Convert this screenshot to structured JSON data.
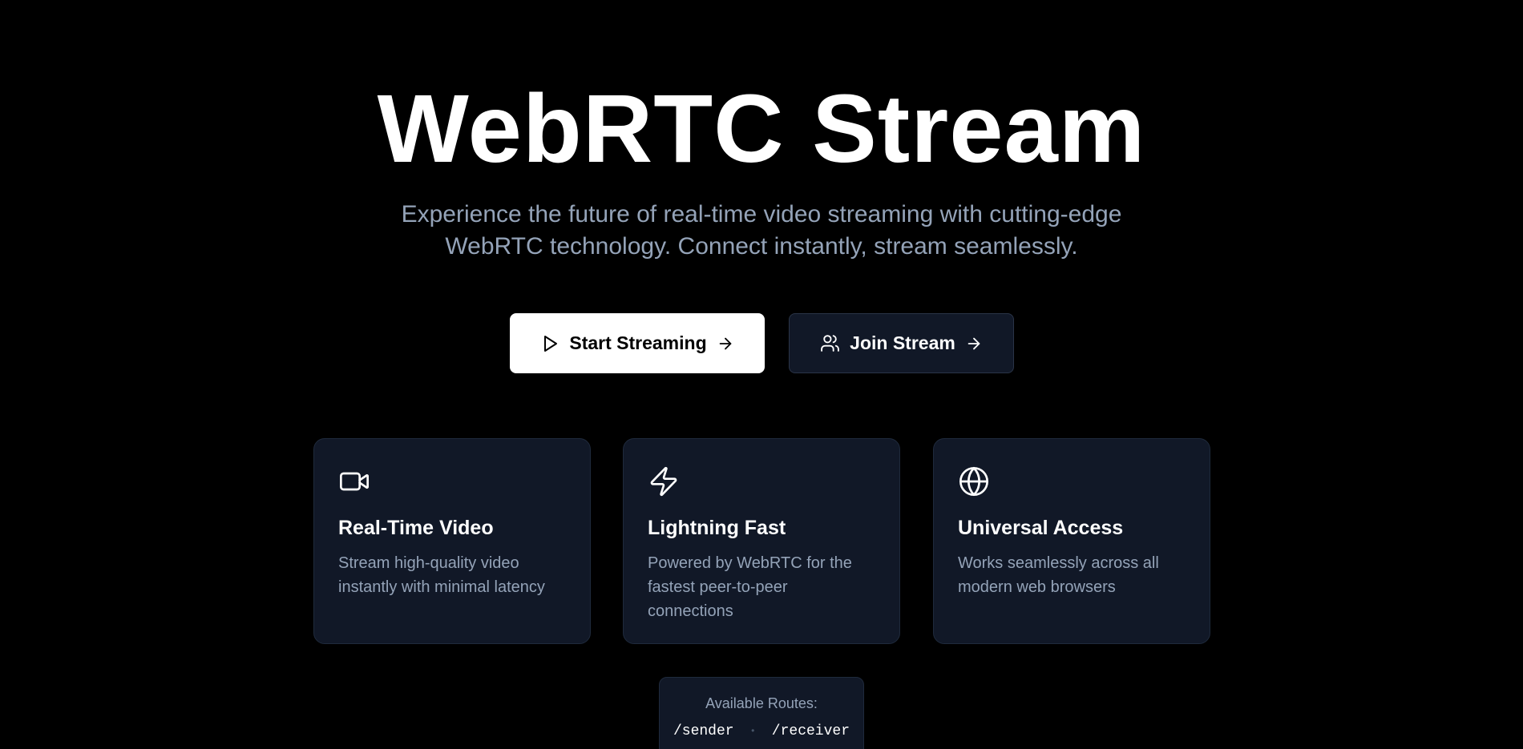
{
  "hero": {
    "title": "WebRTC Stream",
    "subtitle": "Experience the future of real-time video streaming with cutting-edge WebRTC technology. Connect instantly, stream seamlessly."
  },
  "actions": {
    "start": {
      "label": "Start Streaming",
      "icon": "play-icon",
      "trailing_icon": "arrow-right-icon"
    },
    "join": {
      "label": "Join Stream",
      "icon": "users-icon",
      "trailing_icon": "arrow-right-icon"
    }
  },
  "features": [
    {
      "icon": "video-camera-icon",
      "title": "Real-Time Video",
      "description": "Stream high-quality video instantly with minimal latency"
    },
    {
      "icon": "lightning-icon",
      "title": "Lightning Fast",
      "description": "Powered by WebRTC for the fastest peer-to-peer connections"
    },
    {
      "icon": "globe-icon",
      "title": "Universal Access",
      "description": "Works seamlessly across all modern web browsers"
    }
  ],
  "routes": {
    "label": "Available Routes:",
    "items": [
      "/sender",
      "/receiver"
    ],
    "separator": "•"
  },
  "colors": {
    "background": "#000000",
    "card": "#111827",
    "muted_text": "#94a3b8",
    "primary_button": "#ffffff",
    "secondary_button": "#111827"
  }
}
